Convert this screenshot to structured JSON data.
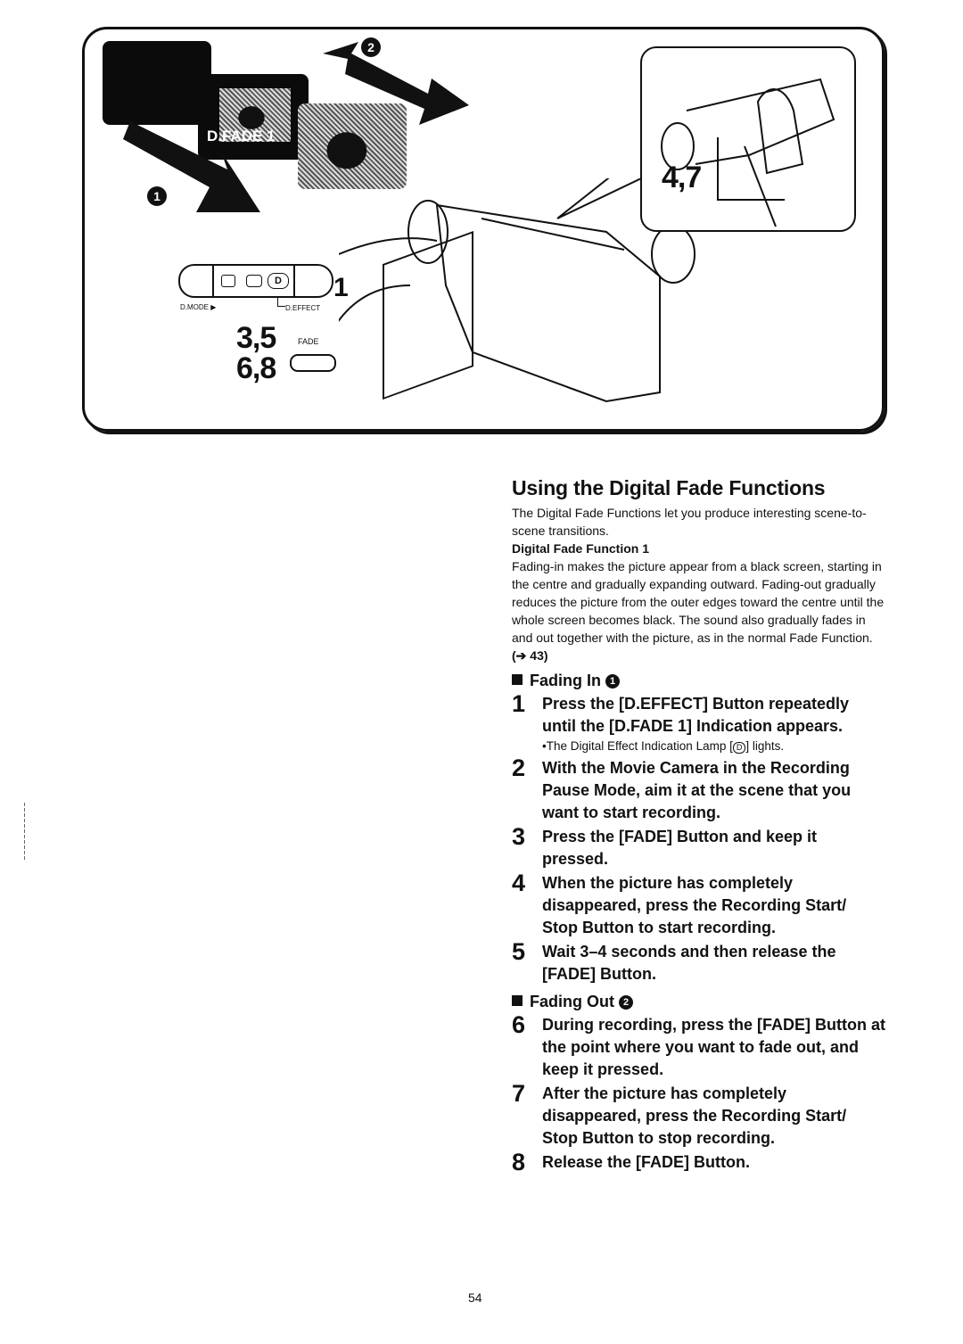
{
  "illustration": {
    "screen_overlay_label": "D.FADE 1",
    "arrow_fade_in_marker": "1",
    "arrow_fade_out_marker": "2",
    "control_panel": {
      "step_label": "1",
      "d_mode_label": "D.MODE ▶",
      "d_effect_label": "D.EFFECT",
      "d_lamp_glyph": "D"
    },
    "fade_button": {
      "label": "FADE",
      "steps_top": "3,5",
      "steps_bottom": "6,8"
    },
    "inset_steps_label": "4,7"
  },
  "article": {
    "title": "Using the Digital Fade Functions",
    "intro": "The Digital Fade Functions let you produce interesting scene-to-scene transitions.",
    "subheading": "Digital Fade Function 1",
    "description": "Fading-in makes the picture appear from a black screen, starting in the centre and gradually expanding outward. Fading-out gradually reduces the picture from the outer edges toward the centre until the whole screen becomes black. The sound also gradually fades in and out together with the picture, as in the normal Fade Function.",
    "reference": "(➔ 43)",
    "sections": [
      {
        "heading": "Fading In",
        "marker": "1",
        "steps": [
          {
            "num": "1",
            "text": "Press the [D.EFFECT] Button repeatedly until the [D.FADE 1] Indication appears.",
            "note_before": "•The Digital Effect Indication Lamp [",
            "note_icon": "D",
            "note_after": "] lights."
          },
          {
            "num": "2",
            "text": "With the Movie Camera in the Recording Pause Mode, aim it at the scene that you want to start recording."
          },
          {
            "num": "3",
            "text": "Press the [FADE] Button and keep it pressed."
          },
          {
            "num": "4",
            "text": "When the picture has completely disappeared, press the Recording Start/ Stop Button to start recording."
          },
          {
            "num": "5",
            "text": "Wait 3–4 seconds and then release the [FADE] Button."
          }
        ]
      },
      {
        "heading": "Fading Out",
        "marker": "2",
        "steps": [
          {
            "num": "6",
            "text": "During recording, press the [FADE] Button at the point where you want to fade out, and keep it pressed."
          },
          {
            "num": "7",
            "text": "After the picture has completely disappeared, press the Recording Start/ Stop Button to stop recording."
          },
          {
            "num": "8",
            "text": "Release the [FADE] Button."
          }
        ]
      }
    ]
  },
  "page_number": "54"
}
